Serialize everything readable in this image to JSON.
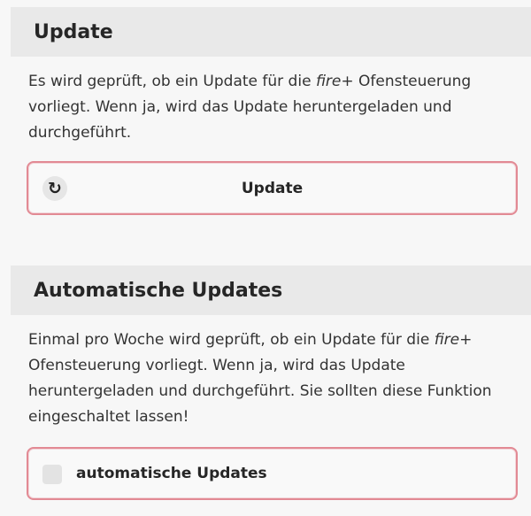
{
  "update_section": {
    "title": "Update",
    "description_before_brand": "Es wird geprüft, ob ein Update für die ",
    "brand": "fire+",
    "description_after_brand": " Ofensteuerung vorliegt. Wenn ja, wird das Update heruntergeladen und durchgeführt.",
    "button_icon": "refresh-icon",
    "button_label": "Update"
  },
  "auto_section": {
    "title": "Automatische Updates",
    "description_before_brand": "Einmal pro Woche wird geprüft, ob ein Update für die ",
    "brand": "fire+",
    "description_after_brand": " Ofensteuerung vorliegt. Wenn ja, wird das Update heruntergeladen und durchgeführt. Sie sollten diese Funktion eingeschaltet lassen!",
    "checkbox_label": "automatische Updates",
    "checkbox_checked": false
  },
  "colors": {
    "header_background": "#e9e9e9",
    "box_border": "#e28a94",
    "page_background": "#f7f7f7"
  }
}
